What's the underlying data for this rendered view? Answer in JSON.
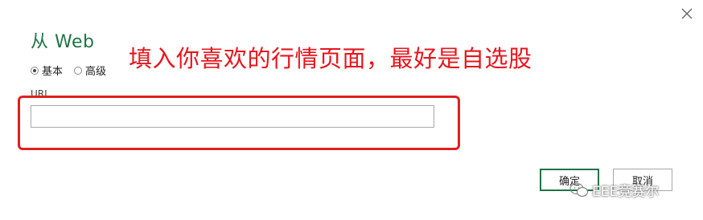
{
  "dialog": {
    "title": "从 Web",
    "close_icon": "close-icon"
  },
  "mode": {
    "options": [
      {
        "label": "基本",
        "checked": true
      },
      {
        "label": "高级",
        "checked": false
      }
    ]
  },
  "url": {
    "label": "URL",
    "value": ""
  },
  "annotation": {
    "text": "填入你喜欢的行情页面，最好是自选股",
    "color": "#e8141c"
  },
  "buttons": {
    "ok_label": "确定",
    "cancel_label": "取消"
  },
  "watermark": {
    "text": "EEE竞赛尔",
    "icon": "wechat-icon"
  },
  "colors": {
    "accent": "#217346",
    "annotation_border": "#e02020"
  }
}
